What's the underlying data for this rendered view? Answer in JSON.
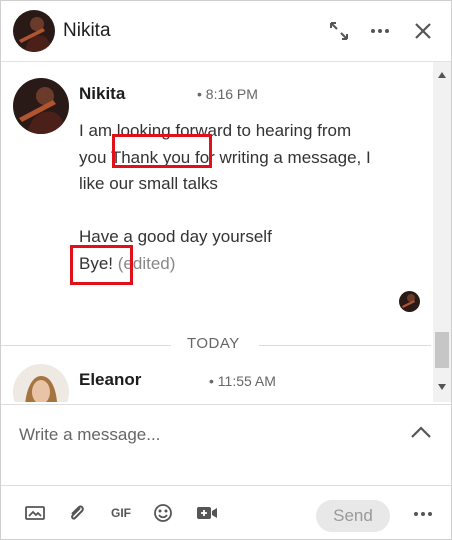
{
  "header": {
    "contact_name": "Nikita",
    "icons": [
      "expand-icon",
      "more-icon",
      "close-icon"
    ]
  },
  "messages": [
    {
      "sender": "Nikita",
      "time": "• 8:16 PM",
      "line1": "I am looking forward to hearing from",
      "line2_a": "you",
      "line2_highlight": "Thank you",
      "line2_b": "for writing a message, I",
      "line3": "like our small talks",
      "line4": "Have a good day yourself",
      "line5_highlight": "Bye!",
      "line5_edited": "(edited)"
    },
    {
      "sender": "Eleanor",
      "time": "• 11:55 AM"
    }
  ],
  "divider_label": "TODAY",
  "composer": {
    "placeholder": "Write a message..."
  },
  "toolbar": {
    "gif_label": "GIF",
    "send_label": "Send",
    "icons": [
      "image-icon",
      "attachment-icon",
      "gif-icon",
      "emoji-icon",
      "video-icon",
      "more-icon"
    ]
  },
  "colors": {
    "highlight": "#e0111a",
    "send_bg": "#e8e8e8",
    "send_text": "#999999"
  }
}
